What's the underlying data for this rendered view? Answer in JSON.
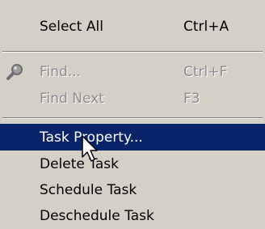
{
  "menu": {
    "items": [
      {
        "label": "Select All",
        "shortcut": "Ctrl+A",
        "enabled": true
      },
      {
        "label": "Find...",
        "shortcut": "Ctrl+F",
        "enabled": false,
        "icon": "magnifier-icon"
      },
      {
        "label": "Find Next",
        "shortcut": "F3",
        "enabled": false
      },
      {
        "label": "Task Property...",
        "shortcut": "",
        "enabled": true,
        "highlighted": true
      },
      {
        "label": "Delete Task",
        "shortcut": "",
        "enabled": true
      },
      {
        "label": "Schedule Task",
        "shortcut": "",
        "enabled": true
      },
      {
        "label": "Deschedule Task",
        "shortcut": "",
        "enabled": true
      }
    ]
  },
  "colors": {
    "menu_background": "#d4d0c8",
    "highlight_background": "#0a246a",
    "highlight_text": "#ffffff",
    "disabled_text": "#8d8d8d"
  }
}
